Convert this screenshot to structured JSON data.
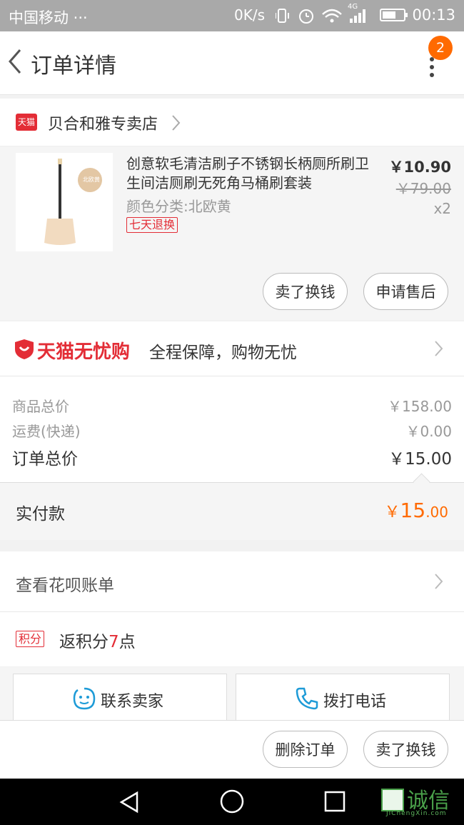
{
  "status_bar": {
    "carrier": "中国移动 ···",
    "speed": "0K/s",
    "network": "4G",
    "time": "00:13"
  },
  "header": {
    "title": "订单详情",
    "badge_count": "2"
  },
  "shop": {
    "logo_text": "天猫",
    "name": "贝合和雅专卖店"
  },
  "product": {
    "image_label": "北欧黄",
    "title": "创意软毛清洁刷子不锈钢长柄厕所刷卫生间洁厕刷无死角马桶刷套装",
    "sku": "颜色分类:北欧黄",
    "tag": "七天退换",
    "price": "￥10.90",
    "original_price": "￥79.00",
    "quantity": "x2",
    "buttons": {
      "sell": "卖了换钱",
      "after_sale": "申请售后"
    }
  },
  "guarantee": {
    "brand": "天猫无忧购",
    "text": "全程保障，购物无忧"
  },
  "summary": {
    "rows": [
      {
        "label": "商品总价",
        "value": "￥158.00"
      },
      {
        "label": "运费(快递)",
        "value": "￥0.00"
      }
    ],
    "total_label": "订单总价",
    "total_value": "￥15.00"
  },
  "paid": {
    "label": "实付款",
    "symbol": "￥",
    "integer": "15",
    "decimal": ".00"
  },
  "huabei": {
    "label": "查看花呗账单"
  },
  "points": {
    "tag": "积分",
    "prefix": "返积分",
    "amount": "7",
    "suffix": "点"
  },
  "contact": {
    "seller": "联系卖家",
    "phone": "拨打电话"
  },
  "actions": {
    "delete": "删除订单",
    "sell": "卖了换钱"
  },
  "watermark": {
    "text": "诚信",
    "sub": "JiChengXin.com"
  },
  "colors": {
    "accent": "#ff6a00",
    "tmall_red": "#e32d36",
    "link_blue": "#1e9bd7"
  }
}
